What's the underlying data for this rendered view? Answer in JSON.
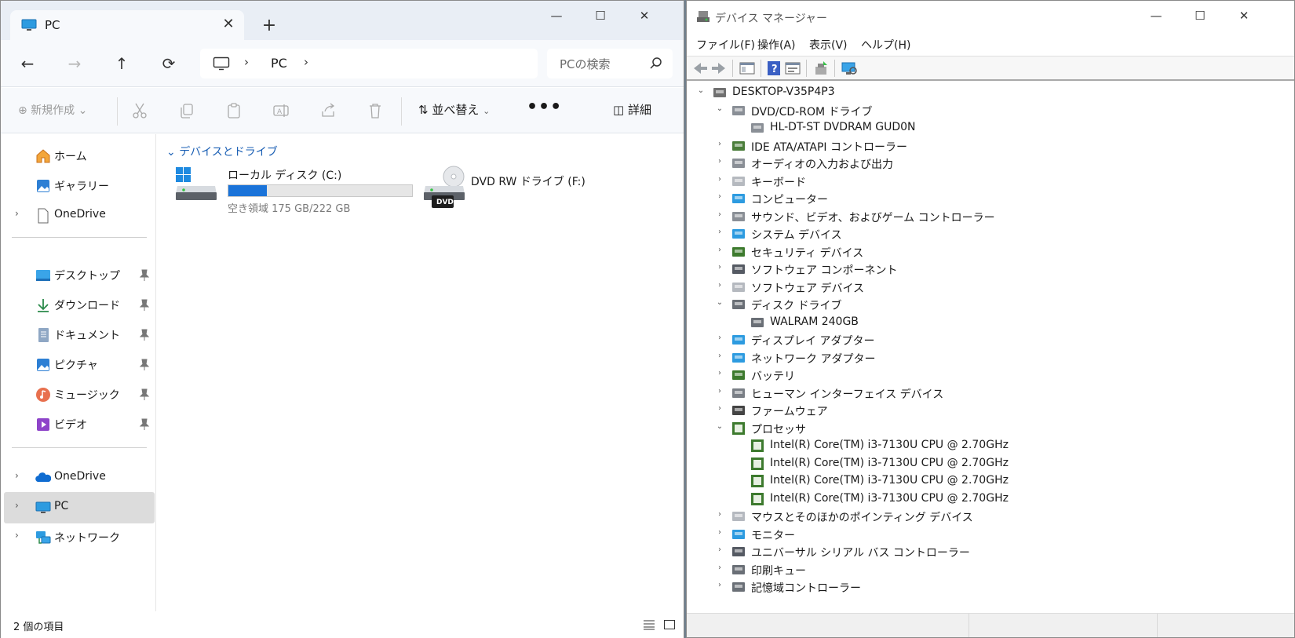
{
  "explorer": {
    "tab": {
      "label": "PC",
      "close": "✕",
      "new_tab": "+"
    },
    "window_controls": {
      "minimize": "—",
      "maximize": "☐",
      "close": "✕"
    },
    "nav": {
      "back": "←",
      "forward": "→",
      "up": "↑",
      "refresh": "⟳"
    },
    "address": {
      "separator": "›",
      "crumb": "PC"
    },
    "search": {
      "placeholder": "PCの検索"
    },
    "toolbar": {
      "new": "新規作成",
      "sort": "並べ替え",
      "more": "•••",
      "details": "詳細"
    },
    "sidebar": {
      "home": "ホーム",
      "gallery": "ギャラリー",
      "onedrive_personal": "OneDrive",
      "desktop": "デスクトップ",
      "downloads": "ダウンロード",
      "documents": "ドキュメント",
      "pictures": "ピクチャ",
      "music": "ミュージック",
      "videos": "ビデオ",
      "onedrive": "OneDrive",
      "pc": "PC",
      "network": "ネットワーク",
      "expand": "›"
    },
    "content": {
      "group_header": "デバイスとドライブ",
      "drive_c": {
        "name": "ローカル ディスク (C:)",
        "free_text": "空き領域 175 GB/222 GB",
        "used_fraction": 0.21
      },
      "drive_f": {
        "name": "DVD RW ドライブ (F:)",
        "badge": "DVD"
      }
    },
    "status": {
      "count": "2 個の項目"
    }
  },
  "devmgr": {
    "title": "デバイス マネージャー",
    "window_controls": {
      "minimize": "—",
      "maximize": "☐",
      "close": "✕"
    },
    "menu": [
      "ファイル(F)",
      "操作(A)",
      "表示(V)",
      "ヘルプ(H)"
    ],
    "tree": [
      {
        "label": "DESKTOP-V35P4P3",
        "level": 0,
        "state": "expanded",
        "icon": "computer-root-icon"
      },
      {
        "label": "DVD/CD-ROM ドライブ",
        "level": 1,
        "state": "expanded",
        "icon": "dvd-drive-icon"
      },
      {
        "label": "HL-DT-ST DVDRAM GUD0N",
        "level": 2,
        "state": "leaf",
        "icon": "dvd-device-icon"
      },
      {
        "label": "IDE ATA/ATAPI コントローラー",
        "level": 1,
        "state": "collapsed",
        "icon": "ide-controller-icon"
      },
      {
        "label": "オーディオの入力および出力",
        "level": 1,
        "state": "collapsed",
        "icon": "audio-io-icon"
      },
      {
        "label": "キーボード",
        "level": 1,
        "state": "collapsed",
        "icon": "keyboard-icon"
      },
      {
        "label": "コンピューター",
        "level": 1,
        "state": "collapsed",
        "icon": "computer-icon"
      },
      {
        "label": "サウンド、ビデオ、およびゲーム コントローラー",
        "level": 1,
        "state": "collapsed",
        "icon": "sound-icon"
      },
      {
        "label": "システム デバイス",
        "level": 1,
        "state": "collapsed",
        "icon": "system-device-icon"
      },
      {
        "label": "セキュリティ デバイス",
        "level": 1,
        "state": "collapsed",
        "icon": "security-device-icon"
      },
      {
        "label": "ソフトウェア コンポーネント",
        "level": 1,
        "state": "collapsed",
        "icon": "software-component-icon"
      },
      {
        "label": "ソフトウェア デバイス",
        "level": 1,
        "state": "collapsed",
        "icon": "software-device-icon"
      },
      {
        "label": "ディスク ドライブ",
        "level": 1,
        "state": "expanded",
        "icon": "disk-drive-icon"
      },
      {
        "label": "WALRAM 240GB",
        "level": 2,
        "state": "leaf",
        "icon": "disk-icon"
      },
      {
        "label": "ディスプレイ アダプター",
        "level": 1,
        "state": "collapsed",
        "icon": "display-adapter-icon"
      },
      {
        "label": "ネットワーク アダプター",
        "level": 1,
        "state": "collapsed",
        "icon": "network-adapter-icon"
      },
      {
        "label": "バッテリ",
        "level": 1,
        "state": "collapsed",
        "icon": "battery-icon"
      },
      {
        "label": "ヒューマン インターフェイス デバイス",
        "level": 1,
        "state": "collapsed",
        "icon": "hid-icon"
      },
      {
        "label": "ファームウェア",
        "level": 1,
        "state": "collapsed",
        "icon": "firmware-icon"
      },
      {
        "label": "プロセッサ",
        "level": 1,
        "state": "expanded",
        "icon": "processor-icon"
      },
      {
        "label": "Intel(R) Core(TM) i3-7130U CPU @ 2.70GHz",
        "level": 2,
        "state": "leaf",
        "icon": "cpu-icon"
      },
      {
        "label": "Intel(R) Core(TM) i3-7130U CPU @ 2.70GHz",
        "level": 2,
        "state": "leaf",
        "icon": "cpu-icon"
      },
      {
        "label": "Intel(R) Core(TM) i3-7130U CPU @ 2.70GHz",
        "level": 2,
        "state": "leaf",
        "icon": "cpu-icon"
      },
      {
        "label": "Intel(R) Core(TM) i3-7130U CPU @ 2.70GHz",
        "level": 2,
        "state": "leaf",
        "icon": "cpu-icon"
      },
      {
        "label": "マウスとそのほかのポインティング デバイス",
        "level": 1,
        "state": "collapsed",
        "icon": "mouse-icon"
      },
      {
        "label": "モニター",
        "level": 1,
        "state": "collapsed",
        "icon": "monitor-icon"
      },
      {
        "label": "ユニバーサル シリアル バス コントローラー",
        "level": 1,
        "state": "collapsed",
        "icon": "usb-icon"
      },
      {
        "label": "印刷キュー",
        "level": 1,
        "state": "collapsed",
        "icon": "printer-icon"
      },
      {
        "label": "記憶域コントローラー",
        "level": 1,
        "state": "collapsed",
        "icon": "storage-controller-icon"
      }
    ]
  },
  "colors": {
    "accent": "#1a73d9",
    "group_header": "#1a5fb4",
    "selected": "#dcdcdc",
    "titlebar": "#e9eef5",
    "cpu_green": "#3d7a2e"
  }
}
